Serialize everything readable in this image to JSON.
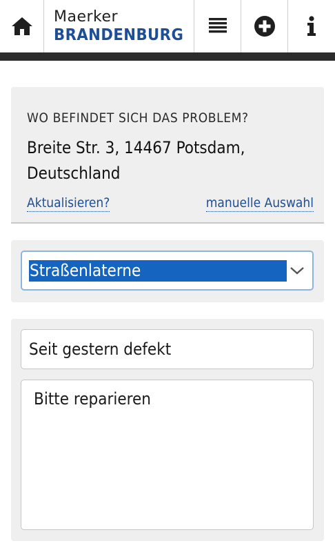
{
  "header": {
    "logo_line1": "Maerker",
    "logo_line2": "BRANDENBURG",
    "icons": [
      "home-icon",
      "list-icon",
      "plus-circle-icon",
      "info-icon"
    ]
  },
  "location": {
    "label": "WO BEFINDET SICH DAS PROBLEM?",
    "address": "Breite Str. 3, 14467 Potsdam, Deutschland",
    "update_link": "Aktualisieren?",
    "manual_link": "manuelle Auswahl"
  },
  "category": {
    "selected": "Straßenlaterne"
  },
  "form": {
    "title_value": "Seit gestern defekt",
    "description_value": "Bitte reparieren"
  },
  "colors": {
    "brand_blue": "#1d4e96",
    "select_highlight": "#1565c0",
    "header_bar": "#2b2b2b",
    "panel_bg": "#efefef"
  }
}
